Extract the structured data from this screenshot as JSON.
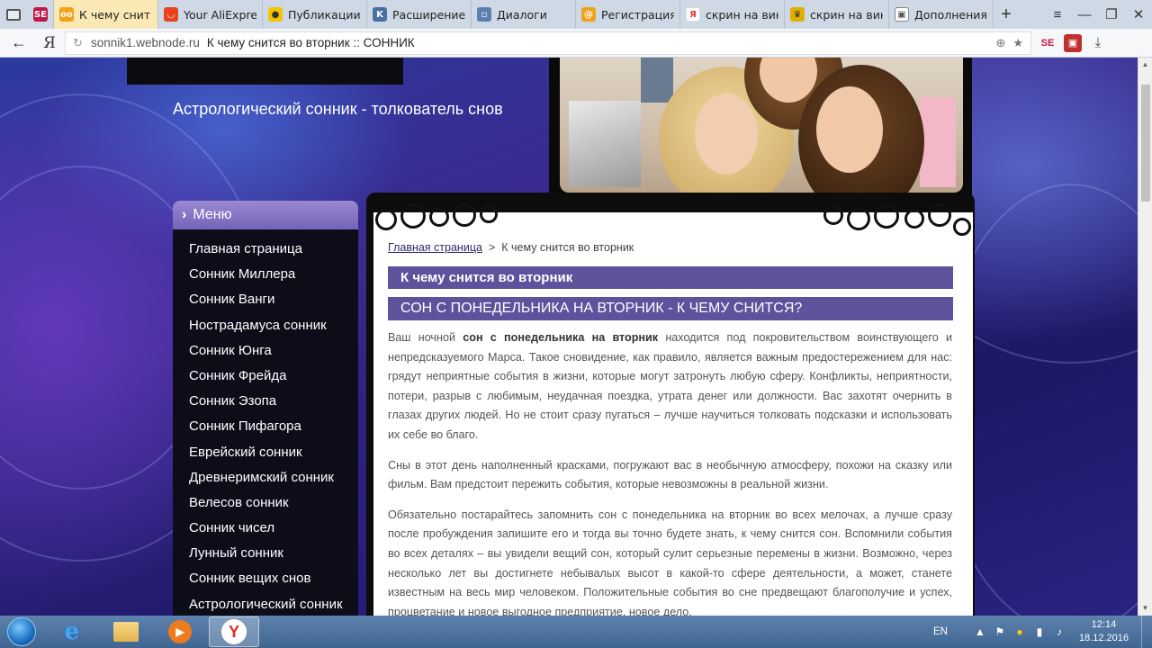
{
  "browser": {
    "tabs": [
      {
        "label": "",
        "favicon": "se-icon",
        "color": "#c0174b"
      },
      {
        "label": "К чему снит",
        "favicon": "owl-eyes-icon",
        "color": "#f0a21a",
        "active": true
      },
      {
        "label": "Your AliExpress",
        "favicon": "aliexpress-icon",
        "color": "#e8431e"
      },
      {
        "label": "Публикации | ",
        "favicon": "zen-icon",
        "color": "#f5c400"
      },
      {
        "label": "Расширение -",
        "favicon": "k-icon",
        "color": "#4a6fa5"
      },
      {
        "label": "Диалоги",
        "favicon": "chat-icon",
        "color": "#5a7fb0"
      },
      {
        "label": "Регистрация н",
        "favicon": "at-icon",
        "color": "#f0a21a"
      },
      {
        "label": "скрин на винд",
        "favicon": "yandex-icon",
        "color": "#e23b2e"
      },
      {
        "label": "скрин на винд",
        "favicon": "crown-icon",
        "color": "#e0b000"
      },
      {
        "label": "Дополнения",
        "favicon": "addons-icon",
        "color": "#555555"
      }
    ],
    "address": {
      "host": "sonnik1.webnode.ru",
      "title": "К чему снится во вторник :: СОННИК"
    }
  },
  "site": {
    "title": "Астрологический сонник - толкователь снов",
    "menu_title": "Меню",
    "menu": [
      "Главная страница",
      "Сонник Миллера",
      "Сонник Ванги",
      "Нострадамуса сонник",
      "Сонник Юнга",
      "Сонник Фрейда",
      "Сонник Эзопа",
      "Сонник Пифагора",
      "Еврейский сонник",
      "Древнеримский сонник",
      "Велесов сонник",
      "Сонник чисел",
      "Лунный сонник",
      "Сонник вещих снов",
      "Астрологический сонник"
    ]
  },
  "content": {
    "breadcrumb": {
      "home": "Главная страница",
      "separator": ">",
      "current": "К чему снится во вторник"
    },
    "h1": "К чему снится во вторник",
    "h2": "СОН С ПОНЕДЕЛЬНИКА НА ВТОРНИК - К ЧЕМУ СНИТСЯ?",
    "p1_start": "Ваш ночной ",
    "p1_bold": "сон с понедельника на вторник",
    "p1_rest": " находится под покровительством воинствующего и непредсказуемого Марса. Такое сновидение, как правило, является важным предостережением для нас: грядут неприятные события в жизни, которые могут затронуть любую сферу. Конфликты, неприятности, потери, разрыв с любимым, неудачная поездка, утрата денег или должности. Вас захотят очернить в глазах других людей. Но не стоит сразу пугаться – лучше научиться толковать подсказки и использовать их себе во благо.",
    "p2": "Сны в этот день наполненный красками, погружают вас в необычную атмосферу, похожи на сказку или фильм. Вам предстоит пережить события, которые невозможны в реальной жизни.",
    "p3": "Обязательно постарайтесь запомнить сон с понедельника на вторник во всех мелочах, а лучше сразу после пробуждения запишите его и тогда вы точно будете знать, к чему снится сон. Вспомнили события во всех деталях – вы увидели вещий сон, который сулит серьезные перемены в жизни. Возможно, через несколько лет вы достигнете небывалых высот в какой-то сфере деятельности, а может, станете известным на весь мир человеком. Положительные события во сне предвещают благополучие и успех, процветание и новое выгодное предприятие, новое дело."
  },
  "taskbar": {
    "lang": "EN",
    "time": "12:14",
    "date": "18.12.2016"
  }
}
